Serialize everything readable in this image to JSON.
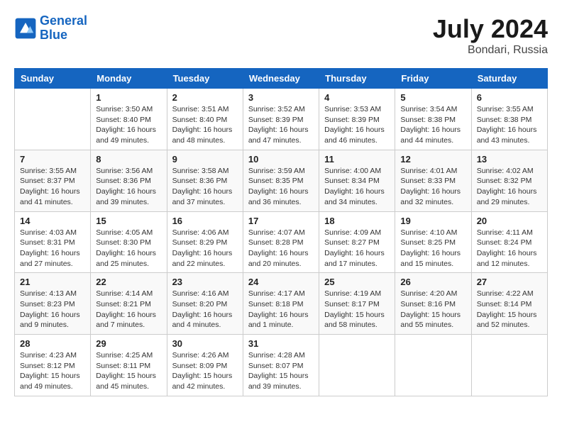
{
  "header": {
    "logo_line1": "General",
    "logo_line2": "Blue",
    "month": "July 2024",
    "location": "Bondari, Russia"
  },
  "weekdays": [
    "Sunday",
    "Monday",
    "Tuesday",
    "Wednesday",
    "Thursday",
    "Friday",
    "Saturday"
  ],
  "weeks": [
    [
      {
        "day": "",
        "content": ""
      },
      {
        "day": "1",
        "content": "Sunrise: 3:50 AM\nSunset: 8:40 PM\nDaylight: 16 hours\nand 49 minutes."
      },
      {
        "day": "2",
        "content": "Sunrise: 3:51 AM\nSunset: 8:40 PM\nDaylight: 16 hours\nand 48 minutes."
      },
      {
        "day": "3",
        "content": "Sunrise: 3:52 AM\nSunset: 8:39 PM\nDaylight: 16 hours\nand 47 minutes."
      },
      {
        "day": "4",
        "content": "Sunrise: 3:53 AM\nSunset: 8:39 PM\nDaylight: 16 hours\nand 46 minutes."
      },
      {
        "day": "5",
        "content": "Sunrise: 3:54 AM\nSunset: 8:38 PM\nDaylight: 16 hours\nand 44 minutes."
      },
      {
        "day": "6",
        "content": "Sunrise: 3:55 AM\nSunset: 8:38 PM\nDaylight: 16 hours\nand 43 minutes."
      }
    ],
    [
      {
        "day": "7",
        "content": "Sunrise: 3:55 AM\nSunset: 8:37 PM\nDaylight: 16 hours\nand 41 minutes."
      },
      {
        "day": "8",
        "content": "Sunrise: 3:56 AM\nSunset: 8:36 PM\nDaylight: 16 hours\nand 39 minutes."
      },
      {
        "day": "9",
        "content": "Sunrise: 3:58 AM\nSunset: 8:36 PM\nDaylight: 16 hours\nand 37 minutes."
      },
      {
        "day": "10",
        "content": "Sunrise: 3:59 AM\nSunset: 8:35 PM\nDaylight: 16 hours\nand 36 minutes."
      },
      {
        "day": "11",
        "content": "Sunrise: 4:00 AM\nSunset: 8:34 PM\nDaylight: 16 hours\nand 34 minutes."
      },
      {
        "day": "12",
        "content": "Sunrise: 4:01 AM\nSunset: 8:33 PM\nDaylight: 16 hours\nand 32 minutes."
      },
      {
        "day": "13",
        "content": "Sunrise: 4:02 AM\nSunset: 8:32 PM\nDaylight: 16 hours\nand 29 minutes."
      }
    ],
    [
      {
        "day": "14",
        "content": "Sunrise: 4:03 AM\nSunset: 8:31 PM\nDaylight: 16 hours\nand 27 minutes."
      },
      {
        "day": "15",
        "content": "Sunrise: 4:05 AM\nSunset: 8:30 PM\nDaylight: 16 hours\nand 25 minutes."
      },
      {
        "day": "16",
        "content": "Sunrise: 4:06 AM\nSunset: 8:29 PM\nDaylight: 16 hours\nand 22 minutes."
      },
      {
        "day": "17",
        "content": "Sunrise: 4:07 AM\nSunset: 8:28 PM\nDaylight: 16 hours\nand 20 minutes."
      },
      {
        "day": "18",
        "content": "Sunrise: 4:09 AM\nSunset: 8:27 PM\nDaylight: 16 hours\nand 17 minutes."
      },
      {
        "day": "19",
        "content": "Sunrise: 4:10 AM\nSunset: 8:25 PM\nDaylight: 16 hours\nand 15 minutes."
      },
      {
        "day": "20",
        "content": "Sunrise: 4:11 AM\nSunset: 8:24 PM\nDaylight: 16 hours\nand 12 minutes."
      }
    ],
    [
      {
        "day": "21",
        "content": "Sunrise: 4:13 AM\nSunset: 8:23 PM\nDaylight: 16 hours\nand 9 minutes."
      },
      {
        "day": "22",
        "content": "Sunrise: 4:14 AM\nSunset: 8:21 PM\nDaylight: 16 hours\nand 7 minutes."
      },
      {
        "day": "23",
        "content": "Sunrise: 4:16 AM\nSunset: 8:20 PM\nDaylight: 16 hours\nand 4 minutes."
      },
      {
        "day": "24",
        "content": "Sunrise: 4:17 AM\nSunset: 8:18 PM\nDaylight: 16 hours\nand 1 minute."
      },
      {
        "day": "25",
        "content": "Sunrise: 4:19 AM\nSunset: 8:17 PM\nDaylight: 15 hours\nand 58 minutes."
      },
      {
        "day": "26",
        "content": "Sunrise: 4:20 AM\nSunset: 8:16 PM\nDaylight: 15 hours\nand 55 minutes."
      },
      {
        "day": "27",
        "content": "Sunrise: 4:22 AM\nSunset: 8:14 PM\nDaylight: 15 hours\nand 52 minutes."
      }
    ],
    [
      {
        "day": "28",
        "content": "Sunrise: 4:23 AM\nSunset: 8:12 PM\nDaylight: 15 hours\nand 49 minutes."
      },
      {
        "day": "29",
        "content": "Sunrise: 4:25 AM\nSunset: 8:11 PM\nDaylight: 15 hours\nand 45 minutes."
      },
      {
        "day": "30",
        "content": "Sunrise: 4:26 AM\nSunset: 8:09 PM\nDaylight: 15 hours\nand 42 minutes."
      },
      {
        "day": "31",
        "content": "Sunrise: 4:28 AM\nSunset: 8:07 PM\nDaylight: 15 hours\nand 39 minutes."
      },
      {
        "day": "",
        "content": ""
      },
      {
        "day": "",
        "content": ""
      },
      {
        "day": "",
        "content": ""
      }
    ]
  ]
}
